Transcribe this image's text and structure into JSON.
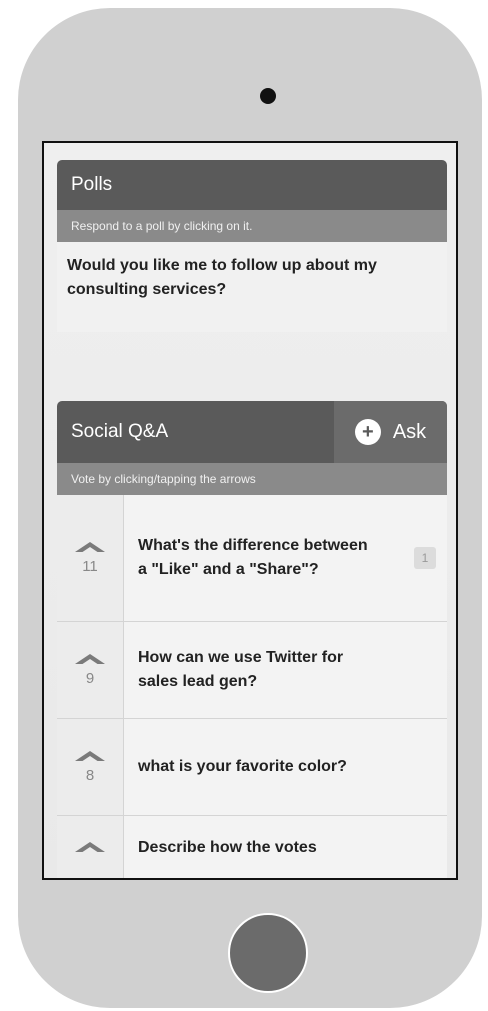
{
  "polls": {
    "title": "Polls",
    "subtitle": "Respond to a poll by clicking on it.",
    "items": [
      "Would you like me to follow up about my consulting services?"
    ]
  },
  "social_qa": {
    "title": "Social Q&A",
    "ask_label": "Ask",
    "subtitle": "Vote by clicking/tapping the arrows",
    "questions": [
      {
        "votes": "11",
        "text": "What's the difference between a \"Like\" and a \"Share\"?",
        "answers": "1"
      },
      {
        "votes": "9",
        "text": "How can we use Twitter for sales lead gen?"
      },
      {
        "votes": "8",
        "text": "what is your favorite color?"
      },
      {
        "votes": "",
        "text": "Describe how the votes"
      }
    ]
  },
  "icons": {
    "ask": "plus-circle-icon",
    "vote": "chevron-up-icon"
  }
}
